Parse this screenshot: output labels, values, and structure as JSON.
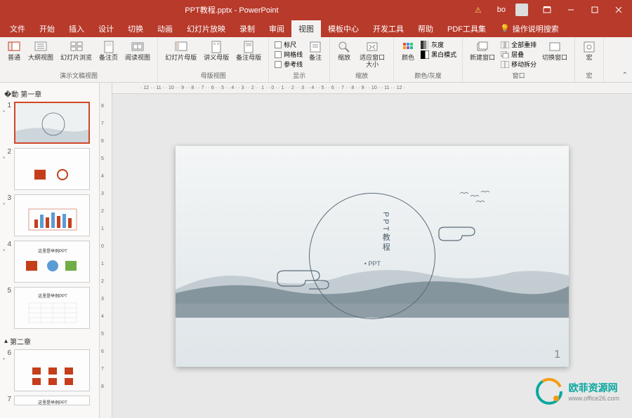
{
  "titlebar": {
    "title": "PPT教程.pptx - PowerPoint",
    "username": "bo"
  },
  "menu": {
    "items": [
      "文件",
      "开始",
      "插入",
      "设计",
      "切换",
      "动画",
      "幻灯片放映",
      "录制",
      "审阅",
      "视图",
      "模板中心",
      "开发工具",
      "帮助",
      "PDF工具集"
    ],
    "active_index": 9,
    "search_placeholder": "操作说明搜索"
  },
  "ribbon": {
    "groups": [
      {
        "label": "演示文稿视图",
        "buttons": [
          "普通",
          "大纲视图",
          "幻灯片浏览",
          "备注页",
          "阅读视图"
        ]
      },
      {
        "label": "母版视图",
        "buttons": [
          "幻灯片母版",
          "讲义母版",
          "备注母版"
        ]
      },
      {
        "label": "显示",
        "checkboxes": [
          "标尺",
          "网格线",
          "参考线"
        ],
        "side_button": "备注"
      },
      {
        "label": "缩放",
        "buttons": [
          "缩放",
          "适应窗口大小"
        ]
      },
      {
        "label": "颜色/灰度",
        "buttons": [
          "颜色",
          "灰度",
          "黑白模式"
        ]
      },
      {
        "label": "窗口",
        "main_button": "新建窗口",
        "side_buttons": [
          "全部重排",
          "层叠",
          "移动拆分"
        ],
        "extra": "切换窗口"
      },
      {
        "label": "宏",
        "buttons": [
          "宏"
        ]
      }
    ]
  },
  "sections": [
    {
      "name": "第一章",
      "slides": [
        1,
        2,
        3,
        4,
        5
      ]
    },
    {
      "name": "第二章",
      "slides": [
        6,
        7
      ]
    }
  ],
  "ruler_h": [
    "12",
    "11",
    "10",
    "9",
    "8",
    "7",
    "6",
    "5",
    "4",
    "3",
    "2",
    "1",
    "0",
    "1",
    "2",
    "3",
    "4",
    "5",
    "6",
    "7",
    "8",
    "9",
    "10",
    "11",
    "12"
  ],
  "ruler_v": [
    "8",
    "7",
    "6",
    "5",
    "4",
    "3",
    "2",
    "1",
    "0",
    "1",
    "2",
    "3",
    "4",
    "5",
    "6",
    "7",
    "8"
  ],
  "slide": {
    "title": "PPT教程",
    "subtitle": "• PPT",
    "page_number": "1"
  },
  "thumbs": {
    "title4": "这里是举例PPT",
    "title5": "这里是举例PPT",
    "title7": "这里是举例PPT"
  },
  "watermark": {
    "name": "欧菲资源网",
    "url": "www.office26.com"
  }
}
